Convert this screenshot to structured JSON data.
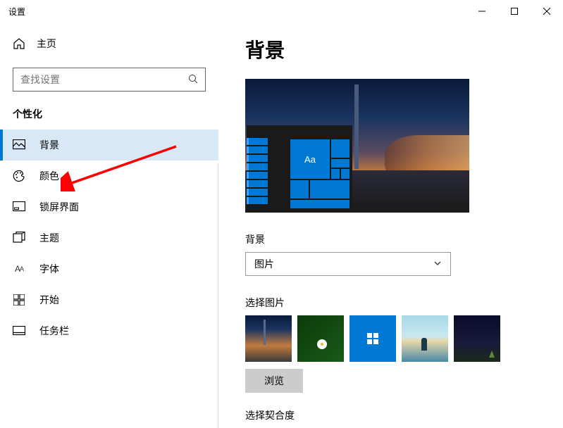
{
  "titlebar": {
    "title": "设置"
  },
  "sidebar": {
    "home": "主页",
    "search_placeholder": "查找设置",
    "section": "个性化",
    "items": [
      {
        "label": "背景"
      },
      {
        "label": "颜色"
      },
      {
        "label": "锁屏界面"
      },
      {
        "label": "主题"
      },
      {
        "label": "字体"
      },
      {
        "label": "开始"
      },
      {
        "label": "任务栏"
      }
    ]
  },
  "content": {
    "title": "背景",
    "preview_tile_text": "Aa",
    "bg_label": "背景",
    "bg_dropdown_value": "图片",
    "choose_label": "选择图片",
    "browse": "浏览",
    "fit_label": "选择契合度"
  }
}
